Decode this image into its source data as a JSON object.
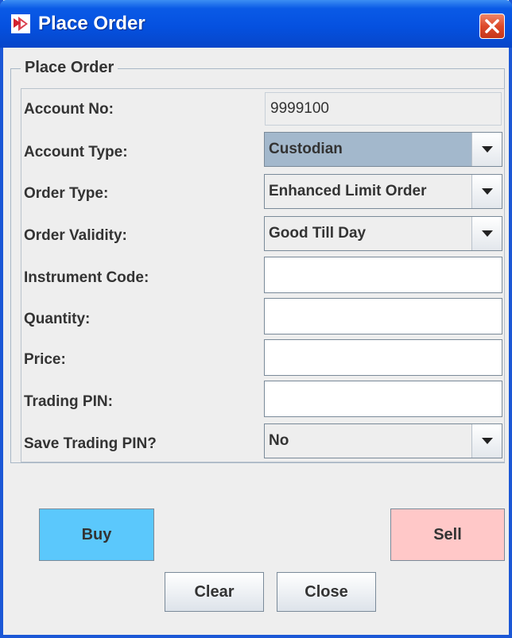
{
  "window": {
    "title": "Place Order",
    "icon": "app-logo-icon",
    "close_icon": "close-icon"
  },
  "group": {
    "title": "Place Order"
  },
  "fields": {
    "account_no": {
      "label": "Account No:",
      "value": "9999100"
    },
    "account_type": {
      "label": "Account Type:",
      "value": "Custodian"
    },
    "order_type": {
      "label": "Order Type:",
      "value": "Enhanced Limit Order"
    },
    "order_validity": {
      "label": "Order Validity:",
      "value": "Good Till Day"
    },
    "instrument_code": {
      "label": "Instrument Code:",
      "value": ""
    },
    "quantity": {
      "label": "Quantity:",
      "value": ""
    },
    "price": {
      "label": "Price:",
      "value": ""
    },
    "trading_pin": {
      "label": "Trading PIN:",
      "value": ""
    },
    "save_trading_pin": {
      "label": "Save Trading PIN?",
      "value": "No"
    }
  },
  "buttons": {
    "buy": "Buy",
    "sell": "Sell",
    "clear": "Clear",
    "close": "Close"
  },
  "colors": {
    "titlebar": "#0551e0",
    "buy": "#5bc8fc",
    "sell": "#ffc8c8",
    "selected_combo": "#a3b8cc"
  }
}
